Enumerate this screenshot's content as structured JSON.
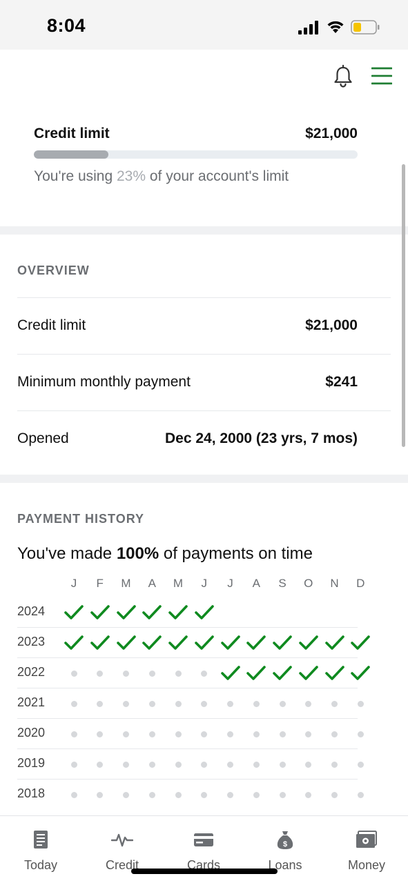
{
  "status_bar": {
    "time": "8:04"
  },
  "credit_limit_card": {
    "label": "Credit limit",
    "value": "$21,000",
    "usage_fraction": 0.23,
    "note_prefix": "You're using ",
    "note_percent": "23%",
    "note_suffix": " of your account's limit"
  },
  "overview": {
    "title": "OVERVIEW",
    "rows": [
      {
        "label": "Credit limit",
        "value": "$21,000"
      },
      {
        "label": "Minimum monthly payment",
        "value": "$241"
      },
      {
        "label": "Opened",
        "value": "Dec 24, 2000 (23 yrs, 7 mos)"
      }
    ]
  },
  "payment_history": {
    "title": "PAYMENT HISTORY",
    "summary_prefix": "You've made ",
    "summary_percent": "100%",
    "summary_suffix": " of payments on time",
    "months": [
      "J",
      "F",
      "M",
      "A",
      "M",
      "J",
      "J",
      "A",
      "S",
      "O",
      "N",
      "D"
    ],
    "rows": [
      {
        "year": "2024",
        "cells": [
          "on-time",
          "on-time",
          "on-time",
          "on-time",
          "on-time",
          "on-time",
          "none",
          "none",
          "none",
          "none",
          "none",
          "none"
        ]
      },
      {
        "year": "2023",
        "cells": [
          "on-time",
          "on-time",
          "on-time",
          "on-time",
          "on-time",
          "on-time",
          "on-time",
          "on-time",
          "on-time",
          "on-time",
          "on-time",
          "on-time"
        ]
      },
      {
        "year": "2022",
        "cells": [
          "no-data",
          "no-data",
          "no-data",
          "no-data",
          "no-data",
          "no-data",
          "on-time",
          "on-time",
          "on-time",
          "on-time",
          "on-time",
          "on-time"
        ]
      },
      {
        "year": "2021",
        "cells": [
          "no-data",
          "no-data",
          "no-data",
          "no-data",
          "no-data",
          "no-data",
          "no-data",
          "no-data",
          "no-data",
          "no-data",
          "no-data",
          "no-data"
        ]
      },
      {
        "year": "2020",
        "cells": [
          "no-data",
          "no-data",
          "no-data",
          "no-data",
          "no-data",
          "no-data",
          "no-data",
          "no-data",
          "no-data",
          "no-data",
          "no-data",
          "no-data"
        ]
      },
      {
        "year": "2019",
        "cells": [
          "no-data",
          "no-data",
          "no-data",
          "no-data",
          "no-data",
          "no-data",
          "no-data",
          "no-data",
          "no-data",
          "no-data",
          "no-data",
          "no-data"
        ]
      },
      {
        "year": "2018",
        "cells": [
          "no-data",
          "no-data",
          "no-data",
          "no-data",
          "no-data",
          "no-data",
          "no-data",
          "no-data",
          "no-data",
          "no-data",
          "no-data",
          "no-data"
        ]
      }
    ]
  },
  "bottom_nav": {
    "items": [
      {
        "label": "Today",
        "icon": "document-icon"
      },
      {
        "label": "Credit",
        "icon": "pulse-icon"
      },
      {
        "label": "Cards",
        "icon": "card-icon"
      },
      {
        "label": "Loans",
        "icon": "money-bag-icon"
      },
      {
        "label": "Money",
        "icon": "banknote-icon"
      }
    ]
  },
  "colors": {
    "accent_green": "#1e7d32",
    "check_green": "#0f8a1f",
    "progress_fill": "#a7abb0",
    "progress_track": "#e9edf1"
  }
}
